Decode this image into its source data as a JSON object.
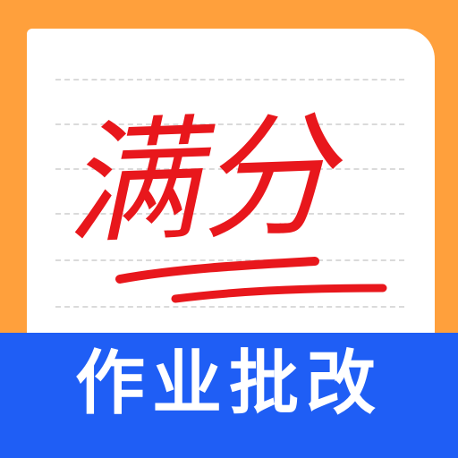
{
  "app_icon": {
    "headline": "满分",
    "banner_label": "作业批改",
    "colors": {
      "background": "#FFA03C",
      "paper": "#FFFFFF",
      "ruled_lines": "#DADADA",
      "handwriting": "#E8171C",
      "banner": "#1F5EF5",
      "banner_text": "#FFFFFF"
    },
    "decorations": [
      "ruled-notebook-paper",
      "red-underline-strokes"
    ]
  }
}
